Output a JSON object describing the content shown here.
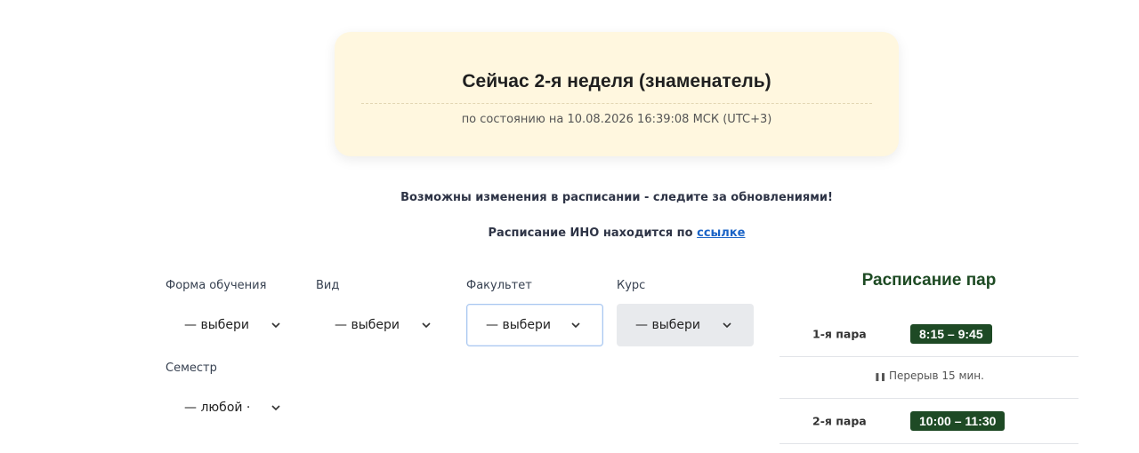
{
  "week_card": {
    "title": "Сейчас 2-я неделя (знаменатель)",
    "status": "по состоянию на 10.08.2026 16:39:08 МСК (UTC+3)"
  },
  "notices": {
    "changes": "Возможны изменения в расписании - следите за обновлениями!",
    "ino_prefix": "Расписание ИНО находится по",
    "ino_link": "ссылке"
  },
  "filters": {
    "study_form": {
      "label": "Форма обучения",
      "value": "— выбери"
    },
    "kind": {
      "label": "Вид",
      "value": "— выбери"
    },
    "faculty": {
      "label": "Факультет",
      "value": "— выбери"
    },
    "course": {
      "label": "Курс",
      "value": "— выбери"
    },
    "semester": {
      "label": "Семестр",
      "value": "— любой ·"
    }
  },
  "schedule": {
    "title": "Расписание пар",
    "lesson_1": {
      "label": "1-я пара",
      "time": "8:15 – 9:45"
    },
    "break_1": {
      "icon": "pause-icon",
      "text": "Перерыв 15 мин."
    },
    "lesson_2": {
      "label": "2-я пара",
      "time": "10:00 – 11:30"
    }
  },
  "colors": {
    "card_bg": "#fff7df",
    "accent_green": "#1e4a25",
    "link": "#1a63c6",
    "disabled_select": "#e8eaed"
  }
}
